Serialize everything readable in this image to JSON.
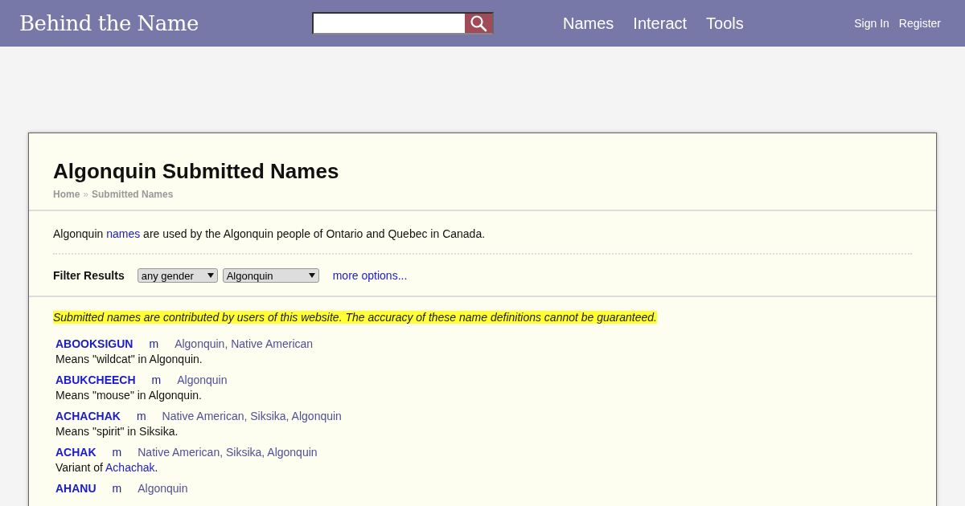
{
  "header": {
    "logo": "Behind the Name",
    "nav": [
      "Names",
      "Interact",
      "Tools"
    ],
    "account": [
      "Sign In",
      "Register"
    ]
  },
  "page": {
    "title": "Algonquin Submitted Names",
    "breadcrumb": [
      "Home",
      "Submitted Names"
    ],
    "breadcrumb_separator": "»",
    "intro": [
      {
        "kind": "text",
        "text": "Algonquin "
      },
      {
        "kind": "link",
        "text": "names"
      },
      {
        "kind": "text",
        "text": " are used by the Algonquin people of Ontario and Quebec in Canada."
      }
    ],
    "filter": {
      "label": "Filter Results",
      "selects": [
        "any gender",
        "Algonquin"
      ],
      "more": "more options..."
    },
    "notice": "Submitted names are contributed by users of this website. The accuracy of these name definitions cannot be guaranteed.",
    "names": [
      {
        "name": "ABOOKSIGUN",
        "gender": "m",
        "usages": "Algonquin, Native American",
        "meaning": [
          {
            "kind": "text",
            "text": "Means \"wildcat\" in Algonquin."
          }
        ]
      },
      {
        "name": "ABUKCHEECH",
        "gender": "m",
        "usages": "Algonquin",
        "meaning": [
          {
            "kind": "text",
            "text": "Means \"mouse\" in Algonquin."
          }
        ]
      },
      {
        "name": "ACHACHAK",
        "gender": "m",
        "usages": "Native American, Siksika, Algonquin",
        "meaning": [
          {
            "kind": "text",
            "text": "Means \"spirit\" in Siksika."
          }
        ]
      },
      {
        "name": "ACHAK",
        "gender": "m",
        "usages": "Native American, Siksika, Algonquin",
        "meaning": [
          {
            "kind": "text",
            "text": "Variant of "
          },
          {
            "kind": "link",
            "text": "Achachak"
          },
          {
            "kind": "text",
            "text": "."
          }
        ]
      },
      {
        "name": "AHANU",
        "gender": "m",
        "usages": "Algonquin"
      }
    ]
  }
}
